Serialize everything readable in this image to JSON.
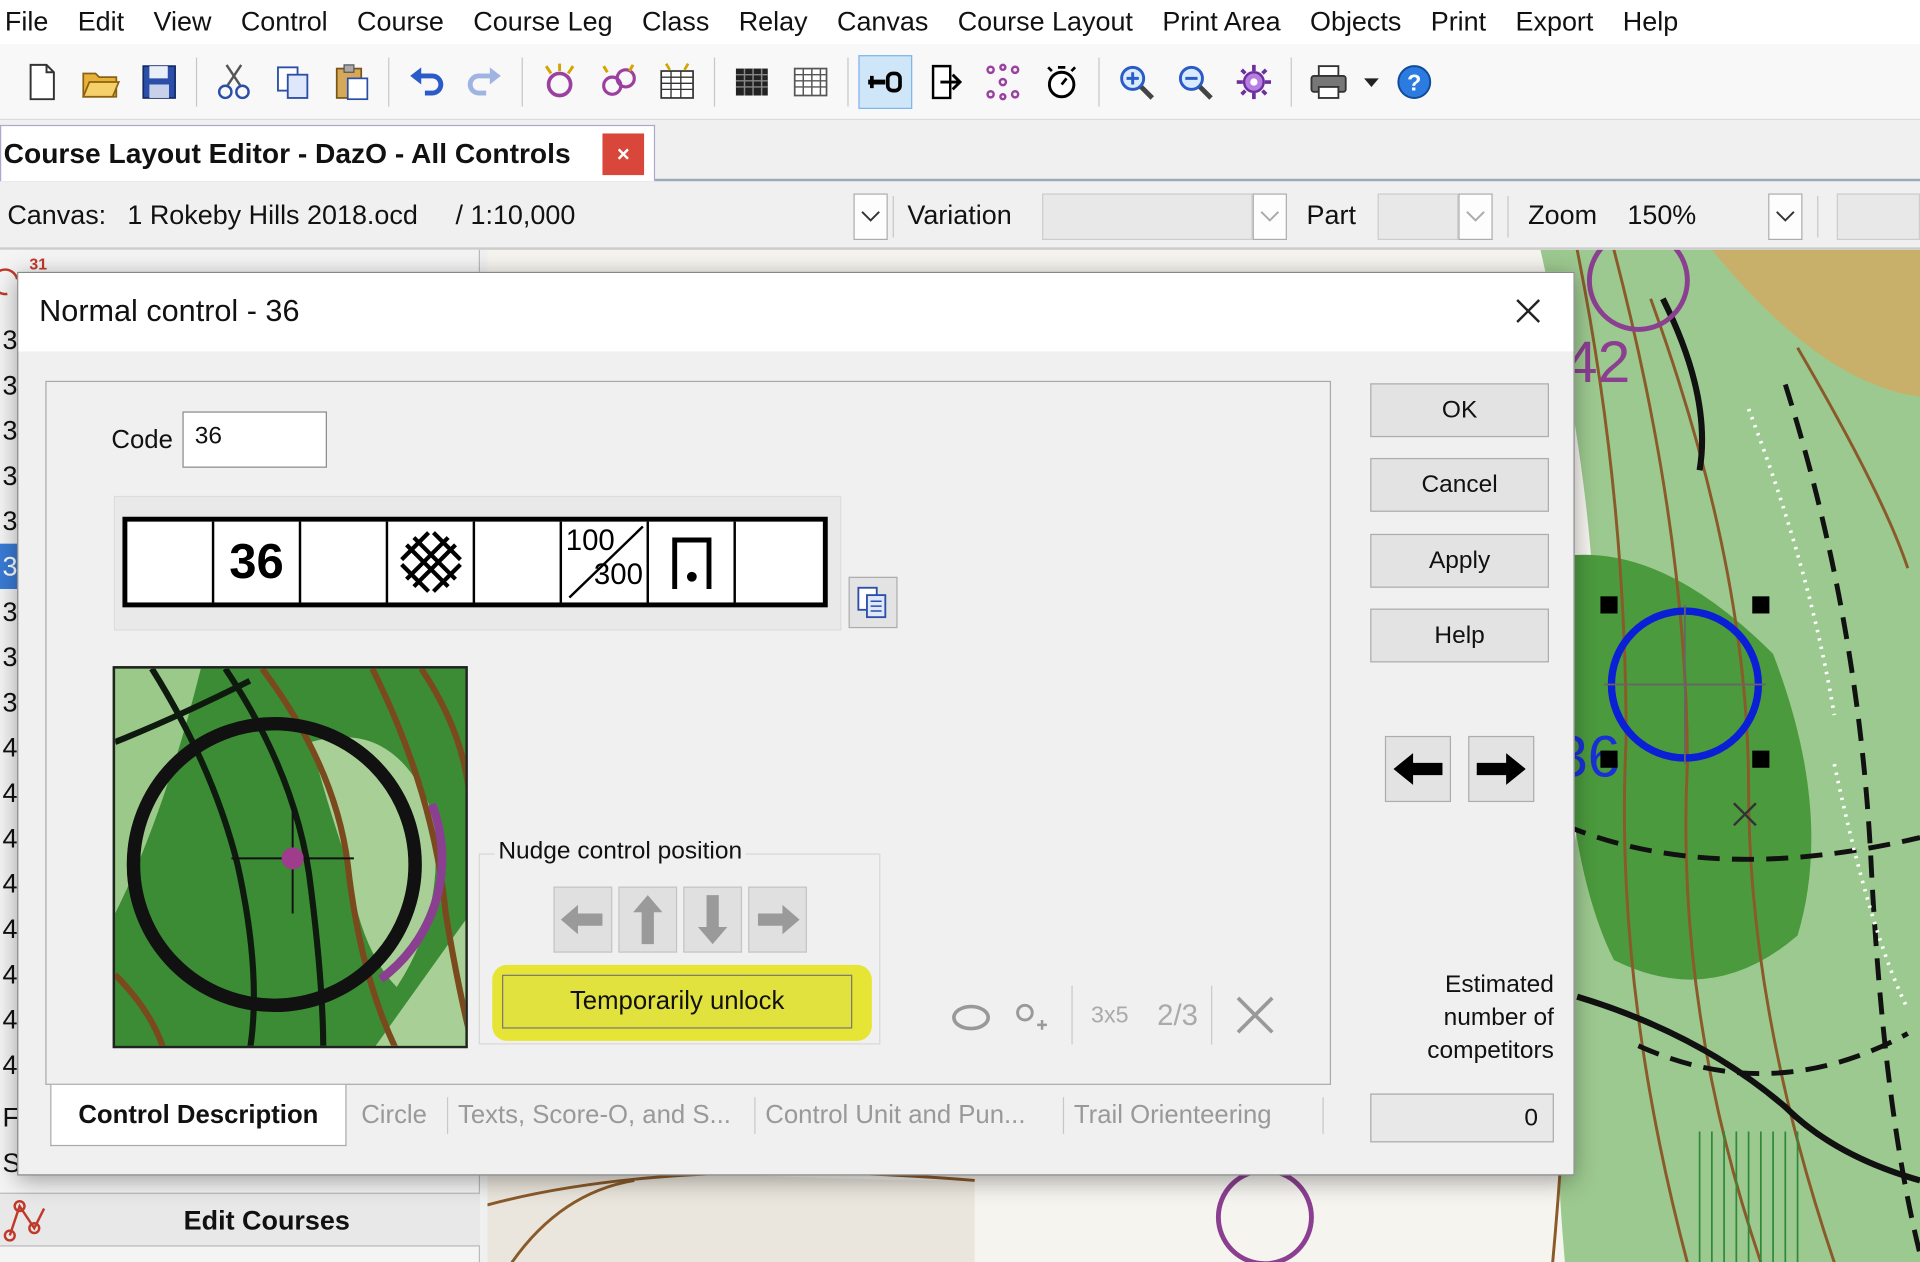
{
  "menu": [
    "File",
    "Edit",
    "View",
    "Control",
    "Course",
    "Course Leg",
    "Class",
    "Relay",
    "Canvas",
    "Course Layout",
    "Print Area",
    "Objects",
    "Print",
    "Export",
    "Help"
  ],
  "toolbar_icons": [
    "new-document-icon",
    "open-folder-icon",
    "save-icon",
    "cut-icon",
    "copy-icon",
    "paste-icon",
    "undo-icon",
    "redo-icon",
    "add-control-icon",
    "edit-controls-icon",
    "control-table-icon",
    "course-table-icon",
    "grid-icon",
    "lock-control-icon",
    "exit-icon",
    "dots-icon",
    "stopwatch-icon",
    "zoom-in-icon",
    "zoom-out-icon",
    "settings-icon",
    "print-icon",
    "help-icon"
  ],
  "doc_tab": {
    "title": "Course Layout Editor - DazO - All Controls",
    "close": "×"
  },
  "canvas_bar": {
    "canvas_label": "Canvas:",
    "canvas_value": "1 Rokeby Hills 2018.ocd",
    "scale": "/ 1:10,000",
    "variation_label": "Variation",
    "part_label": "Part",
    "zoom_label": "Zoom",
    "zoom_value": "150%"
  },
  "left_panel": {
    "top_number": "31",
    "rows": [
      "3",
      "3",
      "3",
      "3",
      "3",
      "3",
      "3",
      "3",
      "3",
      "4",
      "4",
      "4",
      "4",
      "4",
      "4",
      "4",
      "4",
      "F",
      "S"
    ],
    "selected_index": 5,
    "edit_courses": "Edit Courses"
  },
  "map_labels": {
    "control_42": "42",
    "control_36": "36"
  },
  "dialog": {
    "title": "Normal control - 36",
    "code_label": "Code",
    "code_value": "36",
    "description": {
      "number": "36",
      "dim_top": "100",
      "dim_bottom": "300"
    },
    "nudge_label": "Nudge control position",
    "unlock_label": "Temporarily unlock",
    "mini_icons": {
      "count_label": "3x5",
      "fraction_label": "2/3"
    },
    "buttons": {
      "ok": "OK",
      "cancel": "Cancel",
      "apply": "Apply",
      "help": "Help"
    },
    "estimated_label": [
      "Estimated",
      "number of",
      "competitors"
    ],
    "estimated_value": "0",
    "tabs": [
      "Control Description",
      "Circle",
      "Texts, Score-O, and S...",
      "Control Unit and Pun...",
      "Trail Orienteering"
    ],
    "active_tab": 0
  },
  "colors": {
    "accent_blue": "#3a7bd5",
    "highlight_yellow": "#e6e535",
    "close_red": "#d9473a",
    "map_green": "#3b8c34",
    "control_blue": "#0a1fd6",
    "control_purple": "#8b3f91"
  }
}
